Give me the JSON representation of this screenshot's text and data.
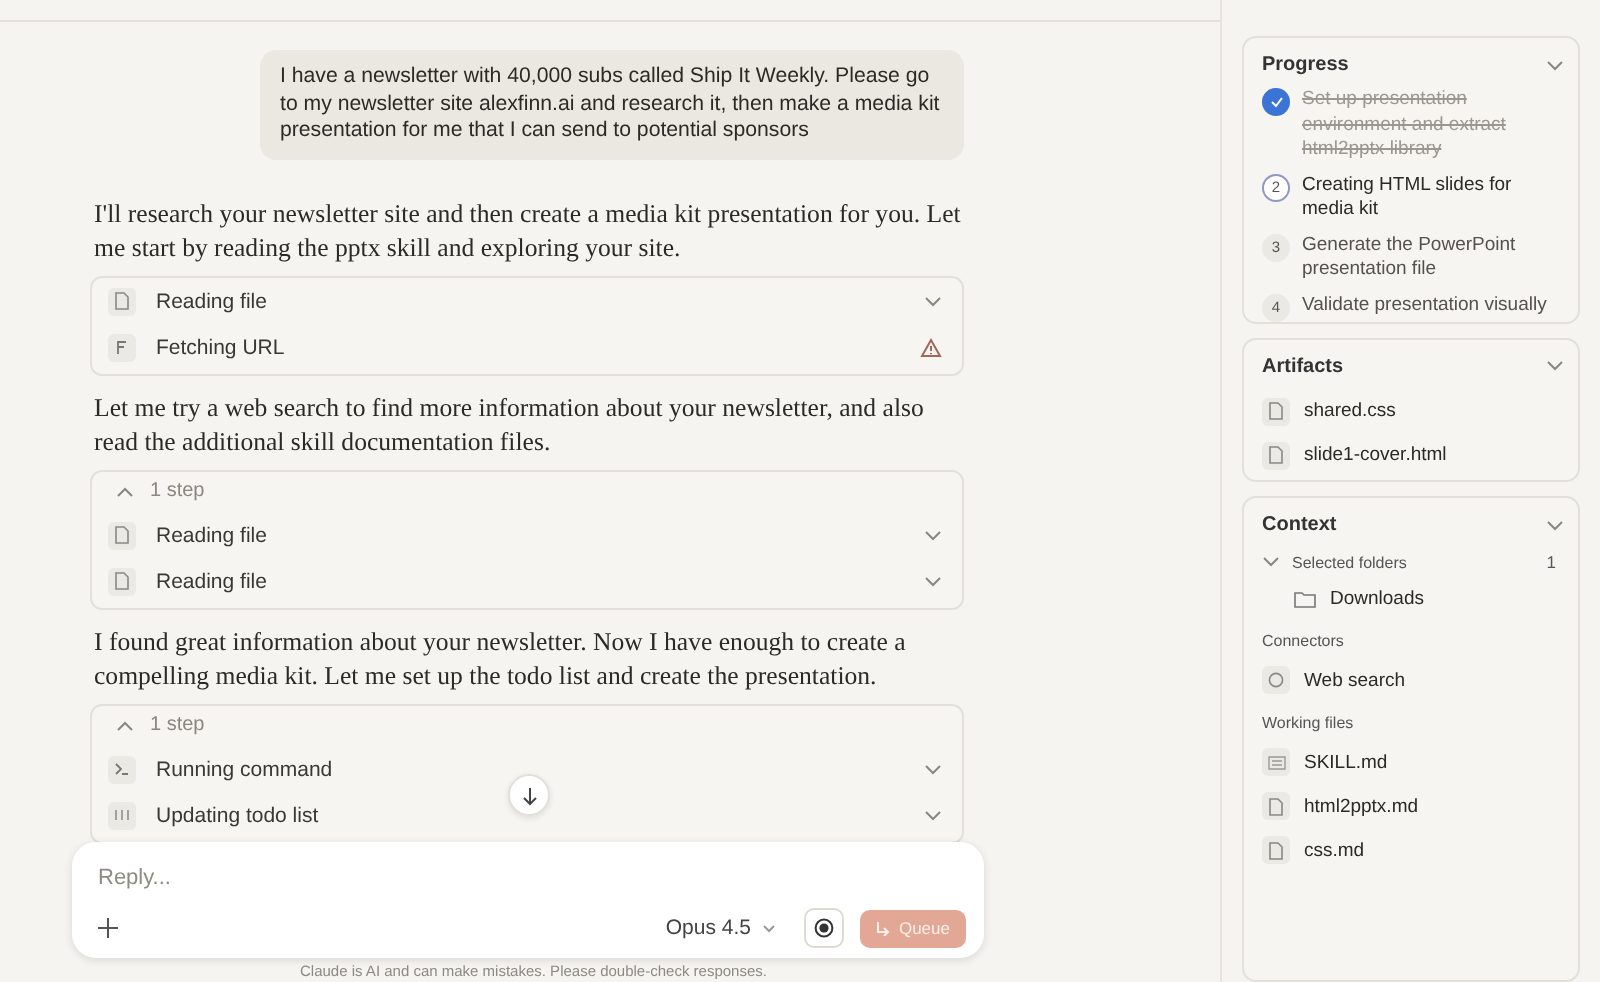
{
  "user_message": "I have a newsletter with 40,000 subs called Ship It Weekly. Please go to my newsletter site alexfinn.ai and research it, then make a media kit presentation for me that I can send to potential sponsors",
  "conversation": [
    {
      "text": "I'll research your newsletter site and then create a media kit presentation for you. Let me start by reading the pptx skill and exploring your site.",
      "steps": {
        "steps": [
          {
            "kind": "file",
            "label": "Reading file",
            "warning": false
          },
          {
            "kind": "url",
            "label": "Fetching URL",
            "warning": true
          }
        ]
      }
    },
    {
      "text": "Let me try a web search to find more information about your newsletter, and also read the additional skill documentation files.",
      "steps": {
        "header": "1 step",
        "expanded": true,
        "steps": [
          {
            "kind": "file",
            "label": "Reading file",
            "warning": false
          },
          {
            "kind": "file",
            "label": "Reading file",
            "warning": false
          }
        ]
      }
    },
    {
      "text": "I found great information about your newsletter. Now I have enough to create a compelling media kit. Let me set up the todo list and create the presentation.",
      "steps": {
        "header": "1 step",
        "expanded": true,
        "steps": [
          {
            "kind": "command",
            "label": "Running command",
            "warning": false
          },
          {
            "kind": "todo",
            "label": "Updating todo list",
            "warning": false
          }
        ]
      }
    }
  ],
  "composer": {
    "placeholder": "Reply...",
    "model": "Opus 4.5",
    "send_label": "Queue",
    "disclaimer": "Claude is AI and can make mistakes. Please double-check responses."
  },
  "sidebar": {
    "progress": {
      "title": "Progress",
      "items": [
        {
          "label": "Set up presentation environment and extract html2pptx library",
          "done": true,
          "current": false
        },
        {
          "number": "2",
          "label": "Creating HTML slides for media kit",
          "done": false,
          "current": true
        },
        {
          "number": "3",
          "label": "Generate the PowerPoint presentation file",
          "done": false,
          "current": false
        },
        {
          "number": "4",
          "label": "Validate presentation visually",
          "done": false,
          "current": false
        }
      ]
    },
    "artifacts": {
      "title": "Artifacts",
      "items": [
        "shared.css",
        "slide1-cover.html"
      ]
    },
    "context": {
      "title": "Context",
      "folders_label": "Selected folders",
      "folders_count": "1",
      "folders_expanded": true,
      "folders": [
        "Downloads"
      ],
      "connectors_label": "Connectors",
      "connectors": [
        "Web search"
      ],
      "working_files_label": "Working files",
      "working_files": [
        {
          "kind": "text",
          "name": "SKILL.md"
        },
        {
          "kind": "doc",
          "name": "html2pptx.md"
        },
        {
          "kind": "doc",
          "name": "css.md"
        }
      ]
    }
  }
}
